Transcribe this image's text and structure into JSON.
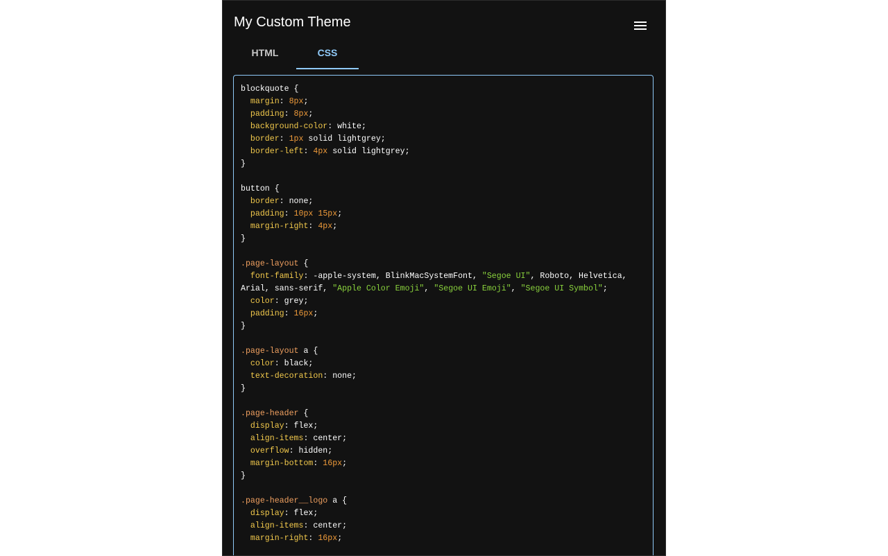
{
  "app": {
    "title": "My Custom Theme"
  },
  "menu": {
    "icon": "hamburger-menu-icon"
  },
  "tabs": [
    {
      "label": "HTML",
      "active": false
    },
    {
      "label": "CSS",
      "active": true
    }
  ],
  "colors": {
    "background": "#121212",
    "accent": "#90caf9",
    "selector": "#f0a060",
    "property": "#f2c94c",
    "number": "#ee9a3a",
    "string": "#8bd43d",
    "text": "#ffffff"
  },
  "editor": {
    "language": "css",
    "lines": [
      [
        [
          "txt",
          "blockquote {"
        ]
      ],
      [
        [
          "txt",
          "  "
        ],
        [
          "prop",
          "margin"
        ],
        [
          "txt",
          ": "
        ],
        [
          "num",
          "8px"
        ],
        [
          "txt",
          ";"
        ]
      ],
      [
        [
          "txt",
          "  "
        ],
        [
          "prop",
          "padding"
        ],
        [
          "txt",
          ": "
        ],
        [
          "num",
          "8px"
        ],
        [
          "txt",
          ";"
        ]
      ],
      [
        [
          "txt",
          "  "
        ],
        [
          "prop",
          "background-color"
        ],
        [
          "txt",
          ": white;"
        ]
      ],
      [
        [
          "txt",
          "  "
        ],
        [
          "prop",
          "border"
        ],
        [
          "txt",
          ": "
        ],
        [
          "num",
          "1px"
        ],
        [
          "txt",
          " solid lightgrey;"
        ]
      ],
      [
        [
          "txt",
          "  "
        ],
        [
          "prop",
          "border-left"
        ],
        [
          "txt",
          ": "
        ],
        [
          "num",
          "4px"
        ],
        [
          "txt",
          " solid lightgrey;"
        ]
      ],
      [
        [
          "txt",
          "}"
        ]
      ],
      [],
      [
        [
          "txt",
          "button {"
        ]
      ],
      [
        [
          "txt",
          "  "
        ],
        [
          "prop",
          "border"
        ],
        [
          "txt",
          ": none;"
        ]
      ],
      [
        [
          "txt",
          "  "
        ],
        [
          "prop",
          "padding"
        ],
        [
          "txt",
          ": "
        ],
        [
          "num",
          "10px"
        ],
        [
          "txt",
          " "
        ],
        [
          "num",
          "15px"
        ],
        [
          "txt",
          ";"
        ]
      ],
      [
        [
          "txt",
          "  "
        ],
        [
          "prop",
          "margin-right"
        ],
        [
          "txt",
          ": "
        ],
        [
          "num",
          "4px"
        ],
        [
          "txt",
          ";"
        ]
      ],
      [
        [
          "txt",
          "}"
        ]
      ],
      [],
      [
        [
          "sel",
          ".page-layout"
        ],
        [
          "txt",
          " {"
        ]
      ],
      [
        [
          "txt",
          "  "
        ],
        [
          "prop",
          "font-family"
        ],
        [
          "txt",
          ": -apple-system, BlinkMacSystemFont, "
        ],
        [
          "str",
          "\"Segoe UI\""
        ],
        [
          "txt",
          ", Roboto, Helvetica, Arial, sans-serif, "
        ],
        [
          "str",
          "\"Apple Color Emoji\""
        ],
        [
          "txt",
          ", "
        ],
        [
          "str",
          "\"Segoe UI Emoji\""
        ],
        [
          "txt",
          ", "
        ],
        [
          "str",
          "\"Segoe UI Symbol\""
        ],
        [
          "txt",
          ";"
        ]
      ],
      [
        [
          "txt",
          "  "
        ],
        [
          "prop",
          "color"
        ],
        [
          "txt",
          ": grey;"
        ]
      ],
      [
        [
          "txt",
          "  "
        ],
        [
          "prop",
          "padding"
        ],
        [
          "txt",
          ": "
        ],
        [
          "num",
          "16px"
        ],
        [
          "txt",
          ";"
        ]
      ],
      [
        [
          "txt",
          "}"
        ]
      ],
      [],
      [
        [
          "sel",
          ".page-layout"
        ],
        [
          "txt",
          " a {"
        ]
      ],
      [
        [
          "txt",
          "  "
        ],
        [
          "prop",
          "color"
        ],
        [
          "txt",
          ": black;"
        ]
      ],
      [
        [
          "txt",
          "  "
        ],
        [
          "prop",
          "text-decoration"
        ],
        [
          "txt",
          ": none;"
        ]
      ],
      [
        [
          "txt",
          "}"
        ]
      ],
      [],
      [
        [
          "sel",
          ".page-header"
        ],
        [
          "txt",
          " {"
        ]
      ],
      [
        [
          "txt",
          "  "
        ],
        [
          "prop",
          "display"
        ],
        [
          "txt",
          ": flex;"
        ]
      ],
      [
        [
          "txt",
          "  "
        ],
        [
          "prop",
          "align-items"
        ],
        [
          "txt",
          ": center;"
        ]
      ],
      [
        [
          "txt",
          "  "
        ],
        [
          "prop",
          "overflow"
        ],
        [
          "txt",
          ": hidden;"
        ]
      ],
      [
        [
          "txt",
          "  "
        ],
        [
          "prop",
          "margin-bottom"
        ],
        [
          "txt",
          ": "
        ],
        [
          "num",
          "16px"
        ],
        [
          "txt",
          ";"
        ]
      ],
      [
        [
          "txt",
          "}"
        ]
      ],
      [],
      [
        [
          "sel",
          ".page-header__logo"
        ],
        [
          "txt",
          " a {"
        ]
      ],
      [
        [
          "txt",
          "  "
        ],
        [
          "prop",
          "display"
        ],
        [
          "txt",
          ": flex;"
        ]
      ],
      [
        [
          "txt",
          "  "
        ],
        [
          "prop",
          "align-items"
        ],
        [
          "txt",
          ": center;"
        ]
      ],
      [
        [
          "txt",
          "  "
        ],
        [
          "prop",
          "margin-right"
        ],
        [
          "txt",
          ": "
        ],
        [
          "num",
          "16px"
        ],
        [
          "txt",
          ";"
        ]
      ]
    ]
  }
}
